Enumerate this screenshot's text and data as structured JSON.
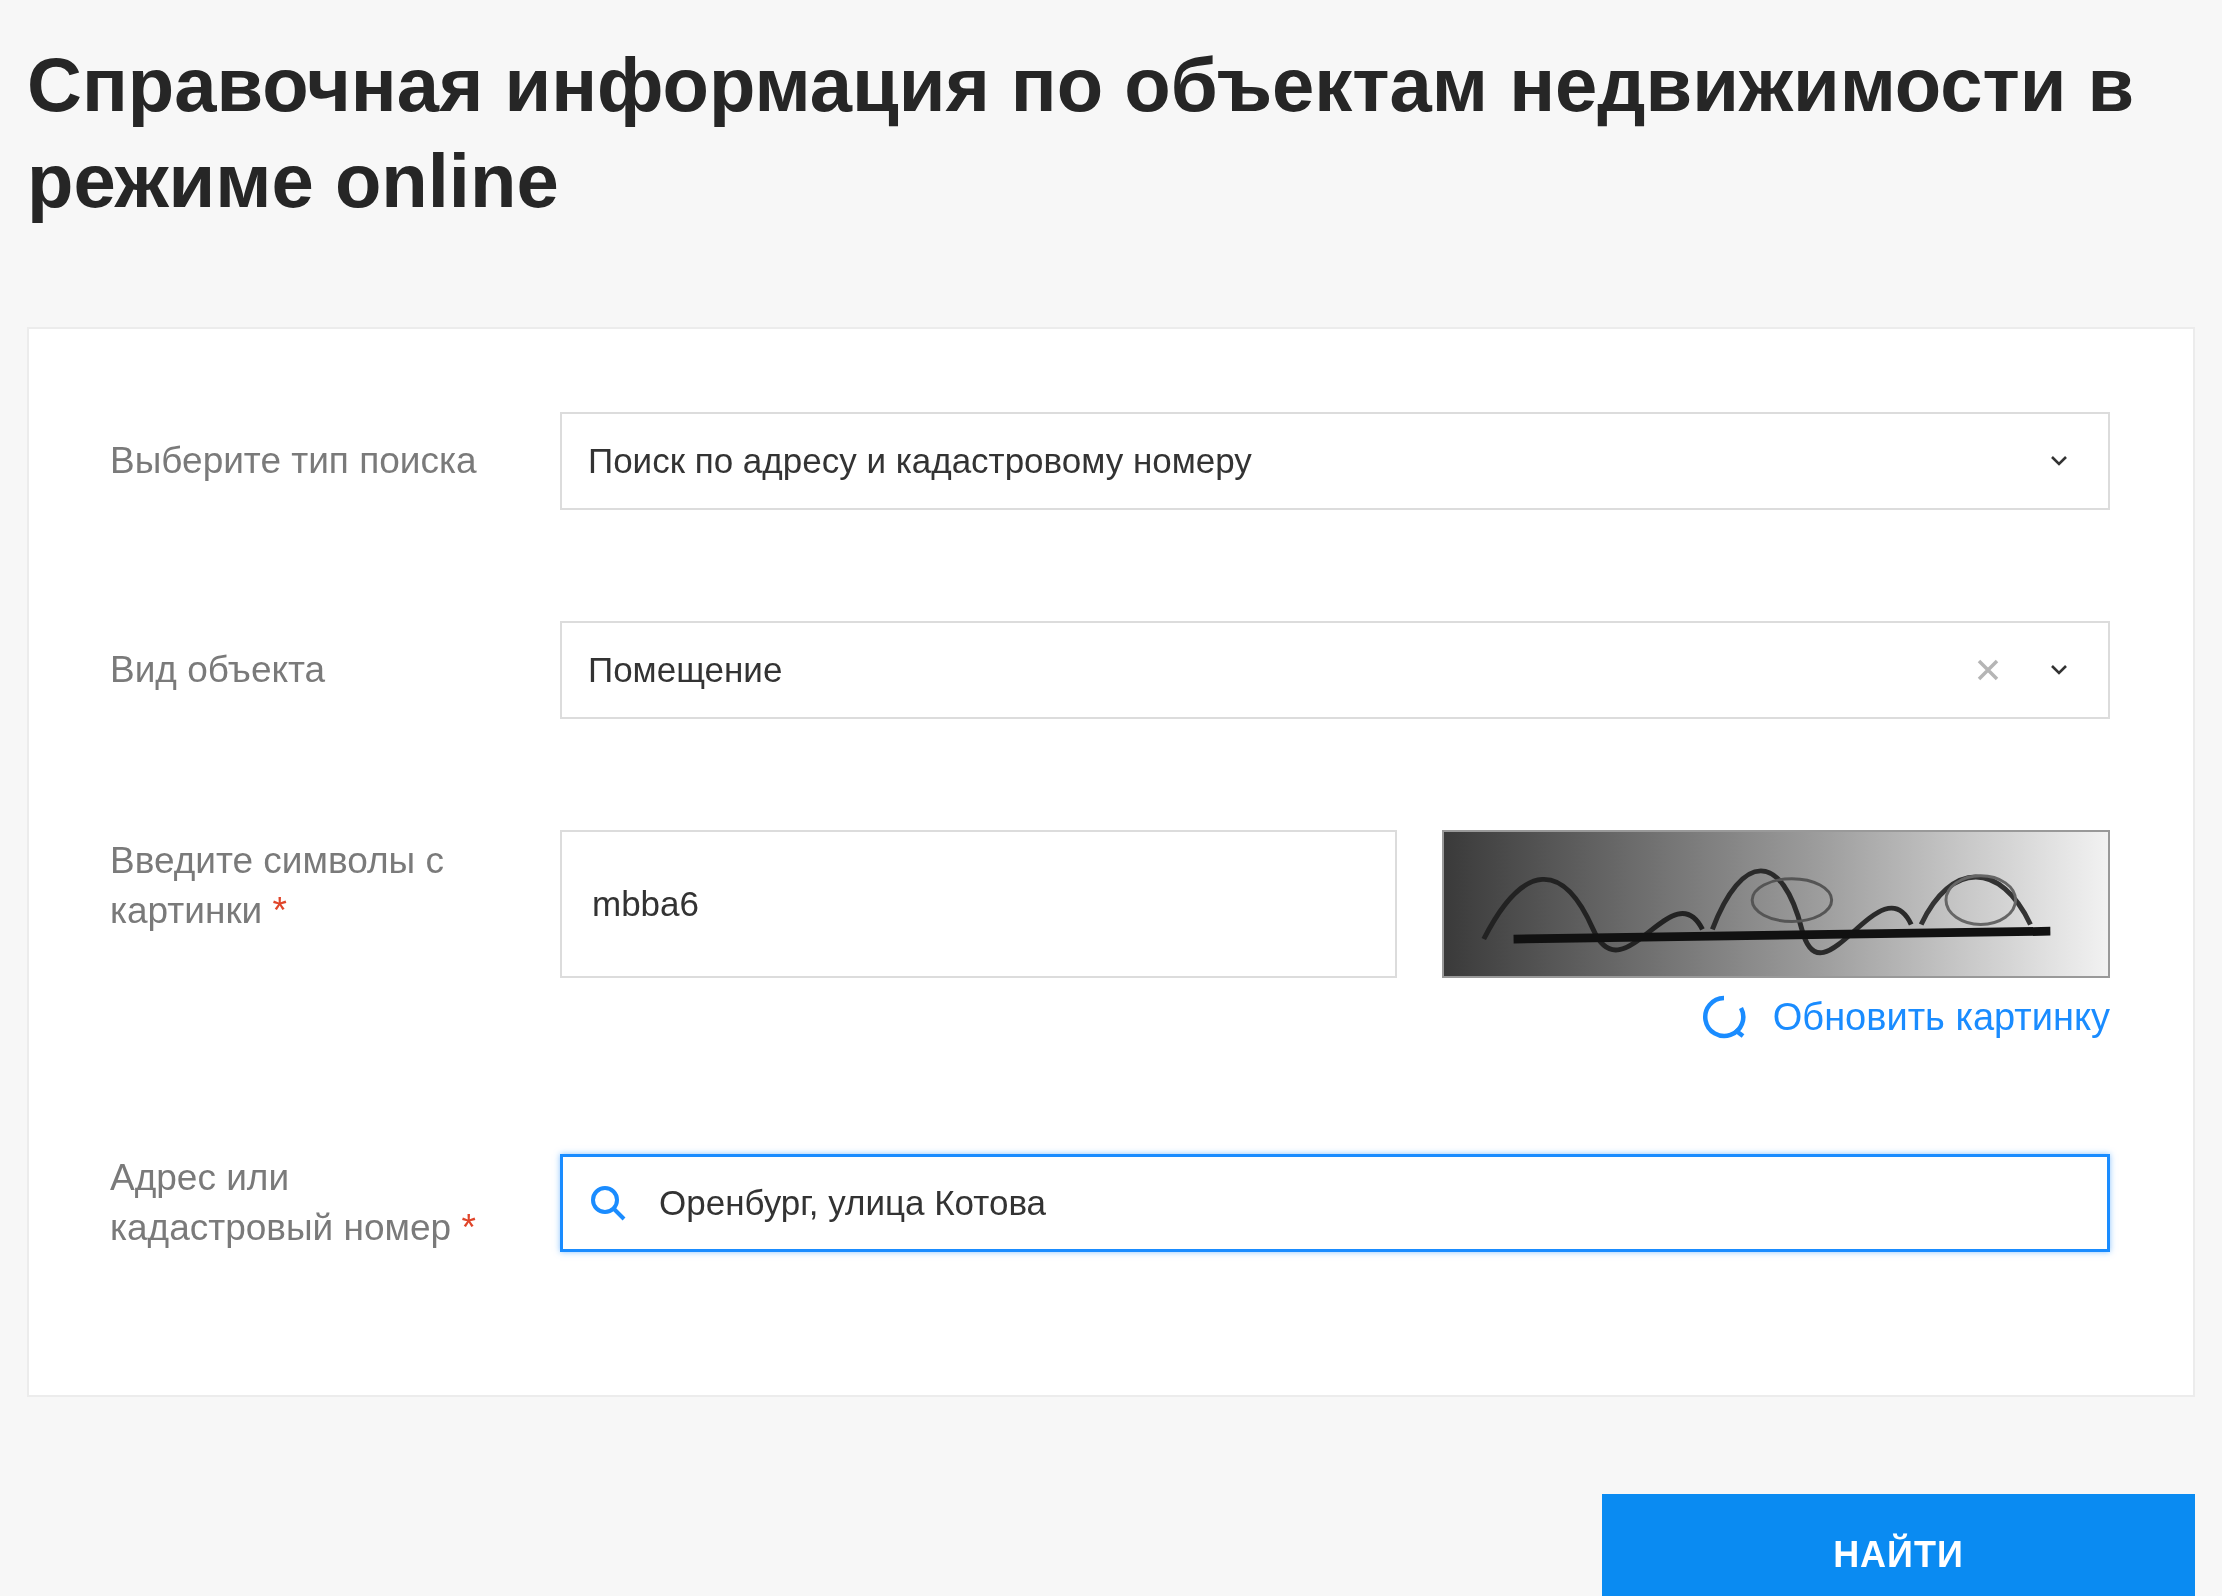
{
  "title": "Справочная информация по объектам недвижимости в режиме online",
  "required_mark": "*",
  "rows": [
    {
      "kind": "select",
      "label": "Выберите тип поиска",
      "required": false,
      "value": "Поиск по адресу и кадастровому номеру",
      "clearable": false
    },
    {
      "kind": "select",
      "label": "Вид объекта",
      "required": false,
      "value": "Помещение",
      "clearable": true
    },
    {
      "kind": "captcha",
      "label": "Введите символы с картинки",
      "required": true,
      "value": "mbba6",
      "refresh_link": "Обновить картинку"
    },
    {
      "kind": "search",
      "label": "Адрес или кадастровый номер",
      "required": true,
      "value": "Оренбург, улица Котова",
      "focused": true
    }
  ],
  "submit_button": "НАЙТИ"
}
